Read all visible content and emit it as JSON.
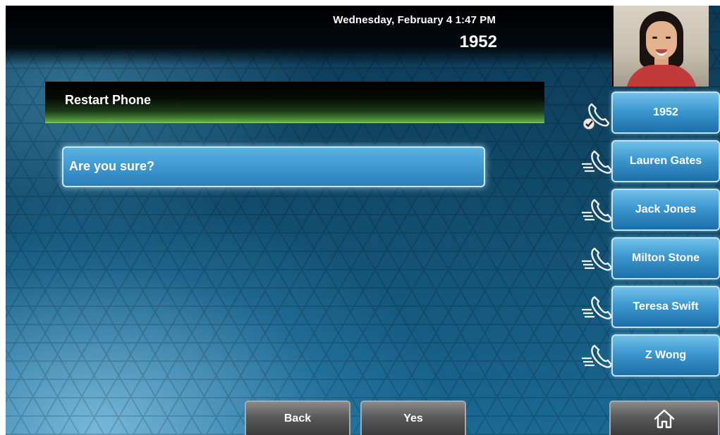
{
  "status": {
    "datetime": "Wednesday, February 4  1:47 PM",
    "extension": "1952"
  },
  "dialog": {
    "title": "Restart Phone",
    "question": "Are you sure?"
  },
  "lines": [
    {
      "label": "1952",
      "icon": "handset-registered-icon"
    },
    {
      "label": "Lauren Gates",
      "icon": "handset-speed-dial-icon"
    },
    {
      "label": "Jack Jones",
      "icon": "handset-speed-dial-icon"
    },
    {
      "label": "Milton Stone",
      "icon": "handset-speed-dial-icon"
    },
    {
      "label": "Teresa Swift",
      "icon": "handset-speed-dial-icon"
    },
    {
      "label": "Z Wong",
      "icon": "handset-speed-dial-icon"
    }
  ],
  "softkeys": {
    "back": "Back",
    "yes": "Yes",
    "home_icon": "home-icon"
  },
  "colors": {
    "title_accent": "#6fae55",
    "button_blue": "#3c98cf"
  }
}
